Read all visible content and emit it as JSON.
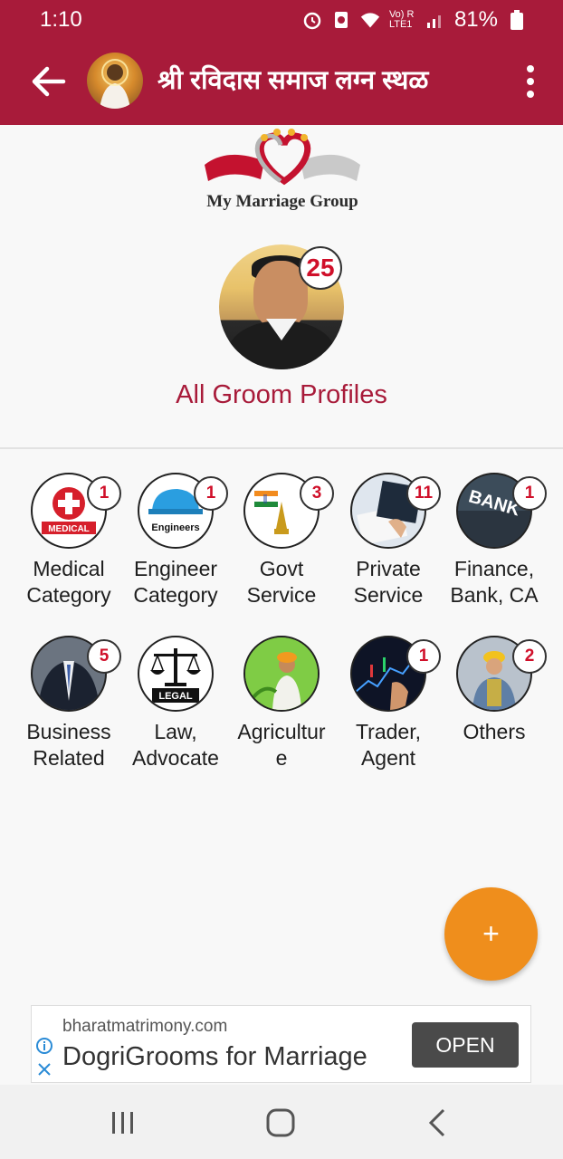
{
  "status": {
    "time": "1:10",
    "battery": "81%",
    "network_label": "Vo) R LTE1"
  },
  "appbar": {
    "title": "श्री रविदास समाज लग्न स्थळ"
  },
  "logo": {
    "brand": "My Marriage Group"
  },
  "groom": {
    "count": "25",
    "label": "All Groom Profiles"
  },
  "categories": [
    {
      "line1": "Medical",
      "line2": "Category",
      "count": "1",
      "icon_text": "MEDICAL"
    },
    {
      "line1": "Engineer",
      "line2": "Category",
      "count": "1",
      "icon_text": "Engineers"
    },
    {
      "line1": "Govt",
      "line2": "Service",
      "count": "3"
    },
    {
      "line1": "Private",
      "line2": "Service",
      "count": "11"
    },
    {
      "line1": "Finance,",
      "line2": "Bank, CA",
      "count": "1",
      "icon_text": "BANK"
    },
    {
      "line1": "Business",
      "line2": "Related",
      "count": "5"
    },
    {
      "line1": "Law,",
      "line2": "Advocate",
      "count": "",
      "icon_text": "LEGAL"
    },
    {
      "line1": "Agricultur",
      "line2": "e",
      "count": ""
    },
    {
      "line1": "Trader,",
      "line2": "Agent",
      "count": "1"
    },
    {
      "line1": "Others",
      "line2": "",
      "count": "2"
    }
  ],
  "fab": {
    "label": "+"
  },
  "ad": {
    "domain": "bharatmatrimony.com",
    "headline": "DogriGrooms for Marriage",
    "cta": "OPEN"
  },
  "colors": {
    "primary": "#a81b3a",
    "accent": "#ef8e1c",
    "badge_text": "#d0102a"
  }
}
